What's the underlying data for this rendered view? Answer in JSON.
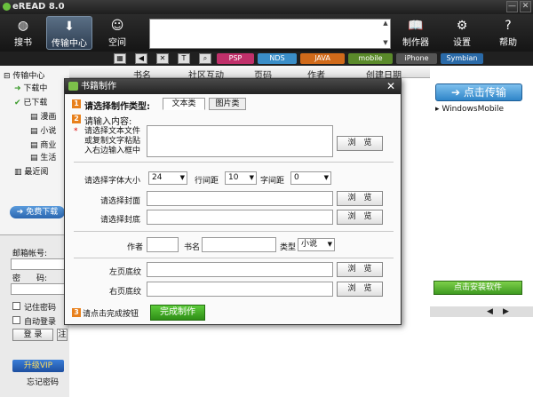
{
  "app": {
    "title": "eREAD 8.0",
    "min": "—",
    "close": "✕"
  },
  "toolbar": {
    "search": "搜书",
    "transfer": "传输中心",
    "space": "空间",
    "maker": "制作器",
    "settings": "设置",
    "help": "帮助"
  },
  "formats": [
    "PSP",
    "NDS",
    "JAVA",
    "mobile",
    "iPhone",
    "Symbian"
  ],
  "left": {
    "tree": [
      "传输中心",
      "下载中",
      "已下载",
      "漫画",
      "小说",
      "商业",
      "生活",
      "最近阅"
    ],
    "free_download": "免费下载",
    "email_label": "邮箱帐号:",
    "password_label": "密　　码:",
    "remember": "记住密码",
    "autologin": "自动登录",
    "login": "登 录",
    "register": "注 册",
    "vip": "升级VIP",
    "forgot": "忘记密码"
  },
  "table": {
    "headers": [
      "书名",
      "社区互动",
      "页码",
      "作者",
      "创建日期"
    ]
  },
  "right": {
    "install": "点击传输",
    "device": "WindowsMobile",
    "install_software": "点击安装软件"
  },
  "dialog": {
    "title": "书籍制作",
    "step1": "请选择制作类型:",
    "tab_text": "文本类",
    "tab_image": "图片类",
    "step2": "请输入内容:",
    "hint": "请选择文本文件\n或复制文字粘贴\n入右边输入框中",
    "browse": "浏　览",
    "font_size_label": "请选择字体大小",
    "font_size": "24",
    "line_spacing_label": "行间距",
    "line_spacing": "10",
    "char_spacing_label": "字间距",
    "char_spacing": "0",
    "cover_label": "请选择封面",
    "back_cover_label": "请选择封底",
    "author_label": "作者",
    "bookname_label": "书名",
    "type_label": "类型",
    "type_value": "小说",
    "left_bg_label": "左页底纹",
    "right_bg_label": "右页底纹",
    "step3": "请点击完成按钮",
    "finish": "完成制作"
  }
}
